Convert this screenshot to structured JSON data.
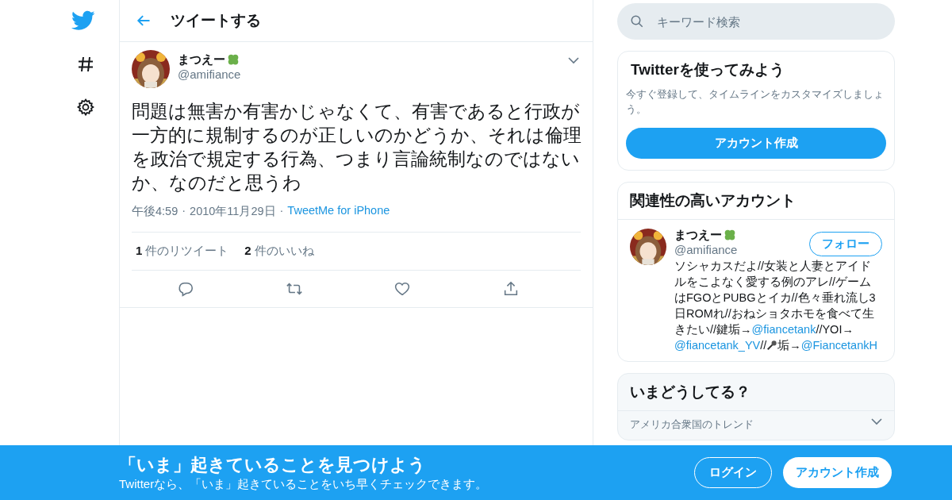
{
  "header": {
    "title": "ツイートする"
  },
  "search": {
    "placeholder": "キーワード検索"
  },
  "tweet": {
    "name": "まつえー",
    "handle": "@amifiance",
    "text": "問題は無害か有害かじゃなくて、有害であると行政が一方的に規制するのが正しいのかどうか、それは倫理を政治で規定する行為、つまり言論統制なのではないか、なのだと思うわ",
    "time": "午後4:59",
    "date": "2010年11月29日",
    "source": "TweetMe for iPhone",
    "separator": "·",
    "stats": [
      {
        "count": "1",
        "label": "件のリツイート"
      },
      {
        "count": "2",
        "label": "件のいいね"
      }
    ],
    "actions": [
      {
        "kind": "reply"
      },
      {
        "kind": "retweet"
      },
      {
        "kind": "like"
      },
      {
        "kind": "share"
      }
    ]
  },
  "signup_card": {
    "title": "Twitterを使ってみよう",
    "text": "今すぐ登録して、タイムラインをカスタマイズしましょう。",
    "button": "アカウント作成"
  },
  "related": {
    "title": "関連性の高いアカウント",
    "name": "まつえー",
    "handle": "@amifiance",
    "follow": "フォロー",
    "bio": [
      {
        "kind": "text",
        "text": "ソシャカスだよ//女装と人妻とアイドルをこよなく愛する例のアレ//ゲームはFGOとPUBGとイカ//色々垂れ流し3日ROMれ//おねショタホモを食べて生きたい//鍵垢→"
      },
      {
        "kind": "link",
        "text": "@fiancetank"
      },
      {
        "kind": "text",
        "text": "//YOI→"
      },
      {
        "kind": "link",
        "text": "@fiancetank_YV"
      },
      {
        "kind": "text",
        "text": "//"
      },
      {
        "kind": "icon"
      },
      {
        "kind": "text",
        "text": "垢→"
      },
      {
        "kind": "link",
        "text": "@FiancetankH"
      }
    ]
  },
  "trends": {
    "title": "いまどうしてる？",
    "subtitle": "アメリカ合衆国のトレンド"
  },
  "banner": {
    "title": "「いま」起きていることを見つけよう",
    "text": "Twitterなら、「いま」起きていることをいち早くチェックできます。",
    "login": "ログイン",
    "signup": "アカウント作成"
  }
}
